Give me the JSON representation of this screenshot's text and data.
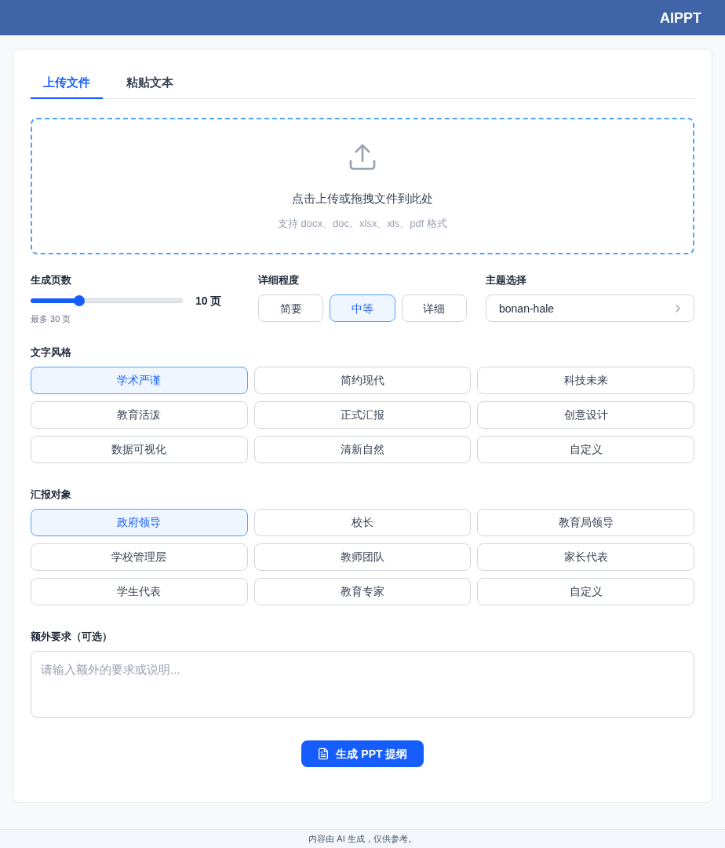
{
  "header": {
    "title": "AIPPT"
  },
  "tabs": [
    {
      "label": "上传文件",
      "selected": true
    },
    {
      "label": "粘贴文本",
      "selected": false
    }
  ],
  "upload": {
    "prompt": "点击上传或拖拽文件到此处",
    "formats": "支持 docx、doc、xlsx、xls、pdf 格式"
  },
  "page_count": {
    "label": "生成页数",
    "level": 0.32,
    "reading": "10 页",
    "note": "最多 30 页"
  },
  "detail": {
    "label": "详细程度",
    "options": [
      {
        "label": "简要",
        "selected": false
      },
      {
        "label": "中等",
        "selected": true
      },
      {
        "label": "详细",
        "selected": false
      }
    ]
  },
  "theme": {
    "label": "主题选择",
    "value": "bonan-hale"
  },
  "style": {
    "label": "文字风格",
    "options": [
      {
        "label": "学术严谨",
        "selected": true
      },
      {
        "label": "简约现代",
        "selected": false
      },
      {
        "label": "科技未来",
        "selected": false
      },
      {
        "label": "教育活泼",
        "selected": false
      },
      {
        "label": "正式汇报",
        "selected": false
      },
      {
        "label": "创意设计",
        "selected": false
      },
      {
        "label": "数据可视化",
        "selected": false
      },
      {
        "label": "清新自然",
        "selected": false
      },
      {
        "label": "自定义",
        "selected": false
      }
    ]
  },
  "audience": {
    "label": "汇报对象",
    "options": [
      {
        "label": "政府领导",
        "selected": true
      },
      {
        "label": "校长",
        "selected": false
      },
      {
        "label": "教育局领导",
        "selected": false
      },
      {
        "label": "学校管理层",
        "selected": false
      },
      {
        "label": "教师团队",
        "selected": false
      },
      {
        "label": "家长代表",
        "selected": false
      },
      {
        "label": "学生代表",
        "selected": false
      },
      {
        "label": "教育专家",
        "selected": false
      },
      {
        "label": "自定义",
        "selected": false
      }
    ]
  },
  "extra": {
    "label": "额外要求（可选）",
    "placeholder": "请输入额外的要求或说明..."
  },
  "submit": {
    "label": "生成 PPT 提纲"
  },
  "footer": {
    "text": "内容由 AI 生成，仅供参考。"
  }
}
